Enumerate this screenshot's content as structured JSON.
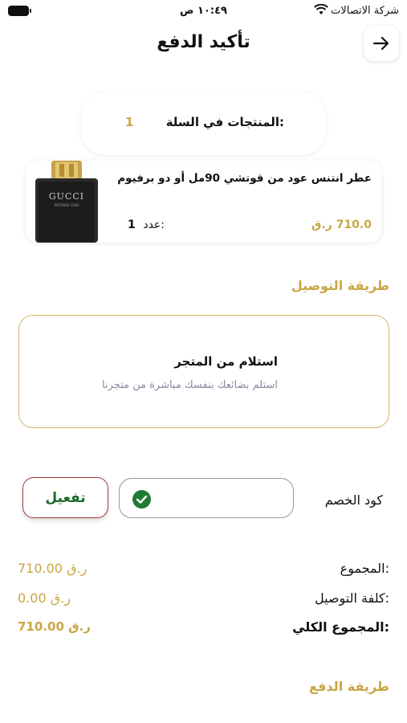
{
  "status_bar": {
    "carrier": "شركة الاتصالات",
    "time": "١٠:٤٩ ص"
  },
  "header": {
    "title": "تأكيد الدفع",
    "back_icon": "arrow-right-icon"
  },
  "cart": {
    "count_label": "المنتجات في السلة:",
    "count_value": "1"
  },
  "product": {
    "name": "عطر انتنس عود من قوتشي 90مل أو دو برفيوم",
    "price": "710.0 ر.ق",
    "qty_label": "عدد:",
    "qty_value": "1",
    "image_brand": "GUCCI",
    "image_subtitle": "INTENSE OUD"
  },
  "delivery": {
    "section_title": "طريقة التوصيل",
    "option_title": "استلام من المتجر",
    "option_desc": "استلم بضائعك بنفسك مباشرة من متجرنا"
  },
  "discount": {
    "label": "كود الخصم",
    "input_value": "",
    "activate_label": "تفعيل"
  },
  "summary": {
    "subtotal_label": "المجموع:",
    "subtotal_value": "710.00 ر.ق",
    "delivery_label": "كلفة التوصيل:",
    "delivery_value": "0.00 ر.ق",
    "total_label": "المجموع الكلي:",
    "total_value": "710.00 ر.ق"
  },
  "payment": {
    "section_title": "طريقة الدفع"
  },
  "colors": {
    "accent_gold": "#c9a646",
    "activate_green": "#1c6b2a",
    "activate_border": "#a83a3a"
  }
}
